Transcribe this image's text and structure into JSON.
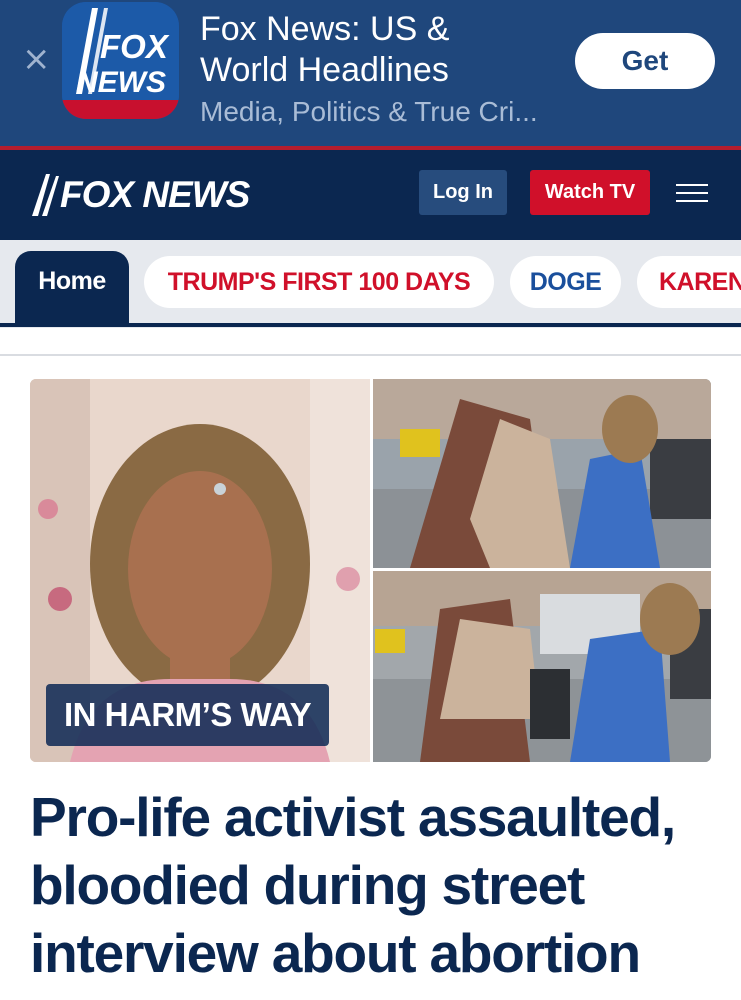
{
  "app_banner": {
    "close_icon": "close-icon",
    "app_icon": "fox-news-app-icon",
    "app_icon_text_1": "FOX",
    "app_icon_text_2": "NEWS",
    "title_line_1": "Fox News: US &",
    "title_line_2": "World Headlines",
    "subtitle": "Media, Politics & True Cri...",
    "get_label": "Get"
  },
  "header": {
    "logo_text": "FOX NEWS",
    "login_label": "Log In",
    "watch_label": "Watch TV",
    "menu_icon": "hamburger-menu-icon"
  },
  "tabs": [
    {
      "label": "Home"
    },
    {
      "label": "TRUMP'S FIRST 100 DAYS"
    },
    {
      "label": "DOGE"
    },
    {
      "label": "KAREN"
    }
  ],
  "article": {
    "tag": "IN HARM’S WAY",
    "headline": "Pro-life activist assaulted, bloodied during street interview about abortion"
  },
  "colors": {
    "banner_bg": "#1f477c",
    "header_bg": "#0b2750",
    "accent_red": "#d0102a",
    "link_blue": "#1a4f9c"
  }
}
